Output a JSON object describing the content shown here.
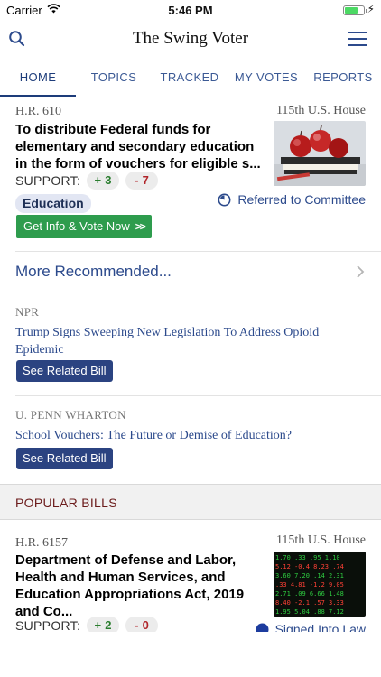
{
  "status_bar": {
    "carrier": "Carrier",
    "time": "5:46 PM",
    "battery_level": 0.7
  },
  "nav": {
    "title": "The Swing Voter"
  },
  "tabs": [
    {
      "label": "HOME",
      "active": true
    },
    {
      "label": "TOPICS",
      "active": false
    },
    {
      "label": "TRACKED",
      "active": false
    },
    {
      "label": "MY VOTES",
      "active": false
    },
    {
      "label": "REPORTS",
      "active": false
    }
  ],
  "featured_bill": {
    "number": "H.R. 610",
    "congress": "115th U.S. House",
    "title": "To distribute Federal funds for elementary and secondary education in the form of vouchers for eligible s...",
    "support_label": "SUPPORT:",
    "yes": "+ 3",
    "no": "- 7",
    "topic": "Education",
    "status": "Referred to Committee",
    "action": "Get Info & Vote Now"
  },
  "more_recommended": "More Recommended...",
  "news": [
    {
      "source": "NPR",
      "headline": "Trump Signs Sweeping New Legislation To Address Opioid Epidemic",
      "button": "See Related Bill"
    },
    {
      "source": "U. PENN WHARTON",
      "headline": "School Vouchers: The Future or Demise of Education?",
      "button": "See Related Bill"
    }
  ],
  "popular_header": "POPULAR BILLS",
  "popular_bill": {
    "number": "H.R. 6157",
    "congress": "115th U.S. House",
    "title": "Department of Defense and Labor, Health and Human Services, and Education Appropriations Act, 2019 and Co...",
    "support_label": "SUPPORT:",
    "yes": "+ 2",
    "no": "- 0",
    "status": "Signed Into Law"
  },
  "colors": {
    "brand_blue": "#2c4a8c",
    "vote_green": "#2e9c4d",
    "popular_red": "#6b1b1b"
  }
}
